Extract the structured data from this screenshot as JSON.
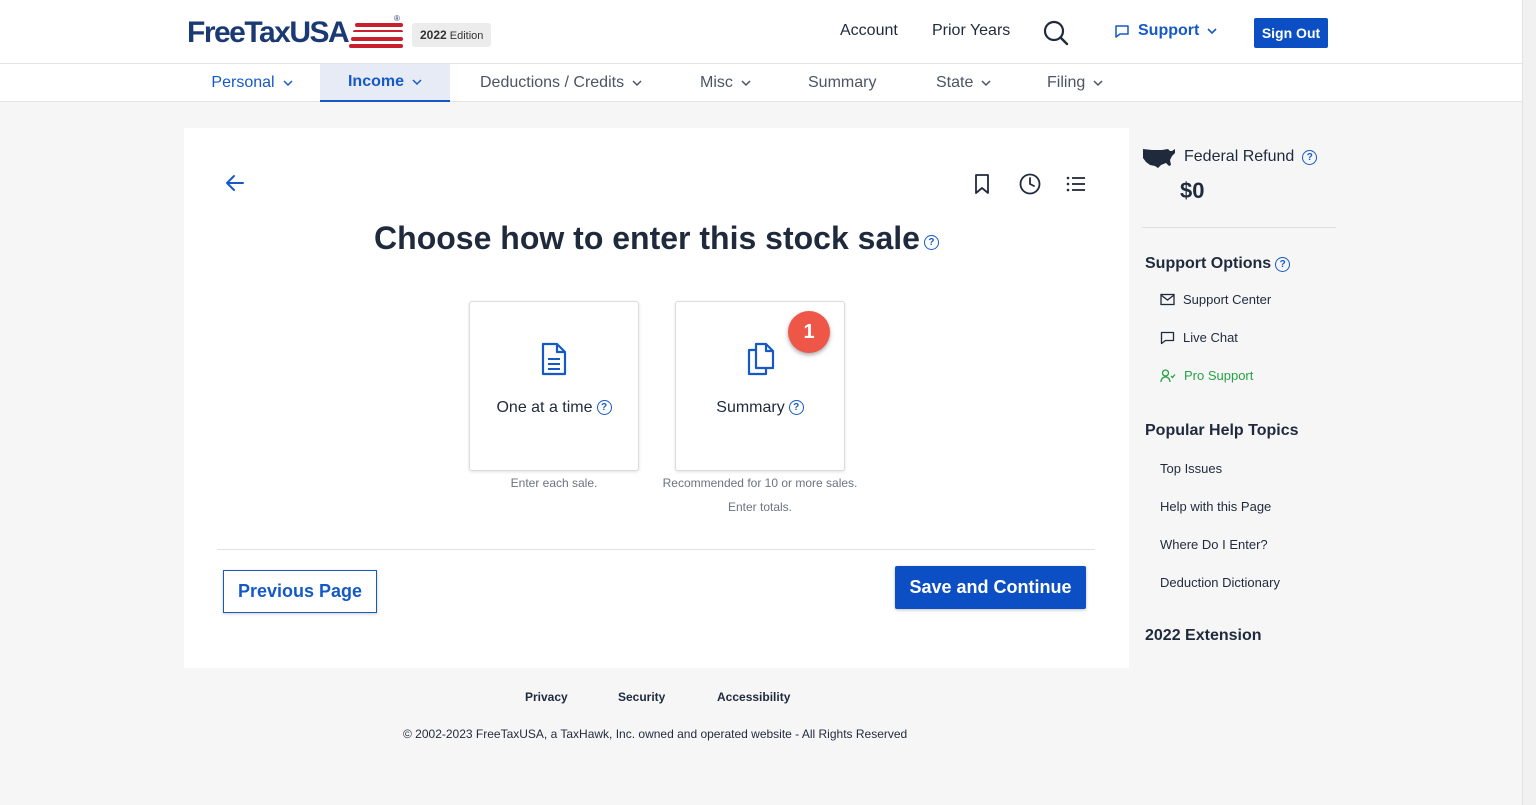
{
  "header": {
    "logo_text": "FreeTaxUSA",
    "logo_reg": "®",
    "edition_year": "2022",
    "edition_label": "Edition",
    "nav": {
      "account": "Account",
      "prior_years": "Prior Years",
      "support": "Support",
      "sign_out": "Sign Out"
    }
  },
  "tabs": [
    {
      "label": "Personal"
    },
    {
      "label": "Income"
    },
    {
      "label": "Deductions / Credits"
    },
    {
      "label": "Misc"
    },
    {
      "label": "Summary"
    },
    {
      "label": "State"
    },
    {
      "label": "Filing"
    }
  ],
  "main": {
    "title": "Choose how to enter this stock sale",
    "help_glyph": "?",
    "options": [
      {
        "label": "One at a time",
        "sub": [
          "Enter each sale."
        ]
      },
      {
        "label": "Summary",
        "sub": [
          "Recommended for 10 or more sales.",
          "Enter totals."
        ]
      }
    ],
    "badge": "1",
    "previous_button": "Previous Page",
    "save_button": "Save and Continue"
  },
  "sidebar": {
    "refund_label": "Federal Refund",
    "refund_amount": "$0",
    "support_heading": "Support Options",
    "support_items": [
      "Support Center",
      "Live Chat",
      "Pro Support"
    ],
    "help_heading": "Popular Help Topics",
    "help_items": [
      "Top Issues",
      "Help with this Page",
      "Where Do I Enter?",
      "Deduction Dictionary"
    ],
    "extension_heading": "2022 Extension"
  },
  "footer": {
    "links": [
      "Privacy",
      "Security",
      "Accessibility"
    ],
    "copyright": "© 2002-2023 FreeTaxUSA, a TaxHawk, Inc. owned and operated website - All Rights Reserved"
  },
  "colors": {
    "brand_blue": "#0c4fc4",
    "link_blue": "#1559c9",
    "pro_green": "#26a344",
    "badge_red": "#ee5648"
  }
}
